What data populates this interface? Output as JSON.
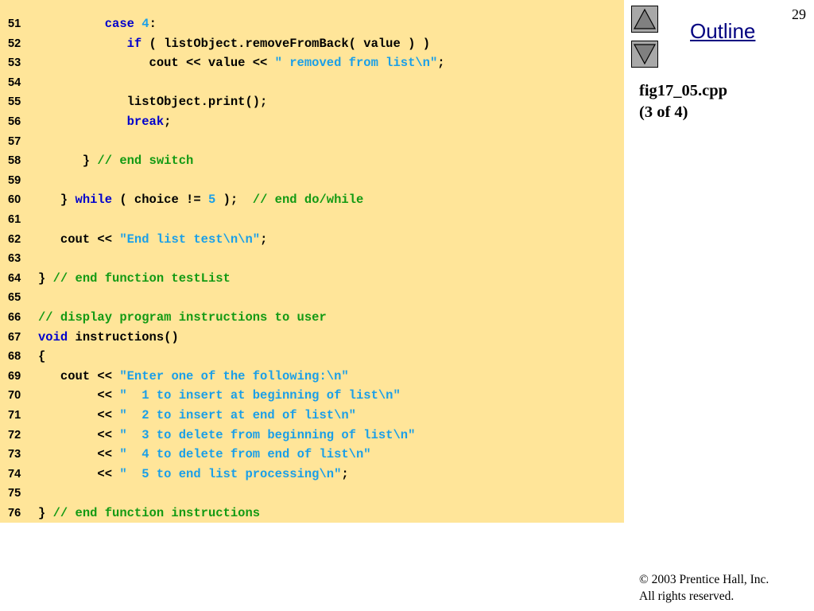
{
  "page_number": "29",
  "outline": {
    "label": "Outline"
  },
  "nav": {
    "up_icon": "triangle-up-icon",
    "down_icon": "triangle-down-icon"
  },
  "caption": {
    "file": "fig17_05.cpp",
    "part": "(3 of 4)"
  },
  "copyright": {
    "line1": "© 2003 Prentice Hall, Inc.",
    "line2": "All rights reserved."
  },
  "colors": {
    "code_background": "#ffe599",
    "keyword": "#0000cc",
    "string": "#1a9fe8",
    "comment": "#139a13",
    "outline_link": "#000080"
  },
  "code_lines": [
    {
      "num": "51",
      "tokens": [
        [
          "pl",
          "         "
        ],
        [
          "kw",
          "case"
        ],
        [
          "pl",
          " "
        ],
        [
          "num",
          "4"
        ],
        [
          "pl",
          ":"
        ]
      ]
    },
    {
      "num": "52",
      "tokens": [
        [
          "pl",
          "            "
        ],
        [
          "kw",
          "if"
        ],
        [
          "pl",
          " ( listObject.removeFromBack( value ) )"
        ]
      ]
    },
    {
      "num": "53",
      "tokens": [
        [
          "pl",
          "               cout << value << "
        ],
        [
          "str",
          "\" removed from list\\n\""
        ],
        [
          "pl",
          ";"
        ]
      ]
    },
    {
      "num": "54",
      "tokens": []
    },
    {
      "num": "55",
      "tokens": [
        [
          "pl",
          "            listObject.print();"
        ]
      ]
    },
    {
      "num": "56",
      "tokens": [
        [
          "pl",
          "            "
        ],
        [
          "kw",
          "break"
        ],
        [
          "pl",
          ";"
        ]
      ]
    },
    {
      "num": "57",
      "tokens": []
    },
    {
      "num": "58",
      "tokens": [
        [
          "pl",
          "      } "
        ],
        [
          "cm",
          "// end switch"
        ]
      ]
    },
    {
      "num": "59",
      "tokens": []
    },
    {
      "num": "60",
      "tokens": [
        [
          "pl",
          "   } "
        ],
        [
          "kw",
          "while"
        ],
        [
          "pl",
          " ( choice != "
        ],
        [
          "num",
          "5"
        ],
        [
          "pl",
          " );  "
        ],
        [
          "cm",
          "// end do/while"
        ]
      ]
    },
    {
      "num": "61",
      "tokens": []
    },
    {
      "num": "62",
      "tokens": [
        [
          "pl",
          "   cout << "
        ],
        [
          "str",
          "\"End list test\\n\\n\""
        ],
        [
          "pl",
          ";"
        ]
      ]
    },
    {
      "num": "63",
      "tokens": []
    },
    {
      "num": "64",
      "tokens": [
        [
          "pl",
          "} "
        ],
        [
          "cm",
          "// end function testList"
        ]
      ]
    },
    {
      "num": "65",
      "tokens": []
    },
    {
      "num": "66",
      "tokens": [
        [
          "cm",
          "// display program instructions to user"
        ]
      ]
    },
    {
      "num": "67",
      "tokens": [
        [
          "kw",
          "void"
        ],
        [
          "pl",
          " instructions()"
        ]
      ]
    },
    {
      "num": "68",
      "tokens": [
        [
          "pl",
          "{"
        ]
      ]
    },
    {
      "num": "69",
      "tokens": [
        [
          "pl",
          "   cout << "
        ],
        [
          "str",
          "\"Enter one of the following:\\n\""
        ]
      ]
    },
    {
      "num": "70",
      "tokens": [
        [
          "pl",
          "        << "
        ],
        [
          "str",
          "\"  1 to insert at beginning of list\\n\""
        ]
      ]
    },
    {
      "num": "71",
      "tokens": [
        [
          "pl",
          "        << "
        ],
        [
          "str",
          "\"  2 to insert at end of list\\n\""
        ]
      ]
    },
    {
      "num": "72",
      "tokens": [
        [
          "pl",
          "        << "
        ],
        [
          "str",
          "\"  3 to delete from beginning of list\\n\""
        ]
      ]
    },
    {
      "num": "73",
      "tokens": [
        [
          "pl",
          "        << "
        ],
        [
          "str",
          "\"  4 to delete from end of list\\n\""
        ]
      ]
    },
    {
      "num": "74",
      "tokens": [
        [
          "pl",
          "        << "
        ],
        [
          "str",
          "\"  5 to end list processing\\n\""
        ],
        [
          "pl",
          ";"
        ]
      ]
    },
    {
      "num": "75",
      "tokens": []
    },
    {
      "num": "76",
      "tokens": [
        [
          "pl",
          "} "
        ],
        [
          "cm",
          "// end function instructions"
        ]
      ]
    }
  ]
}
